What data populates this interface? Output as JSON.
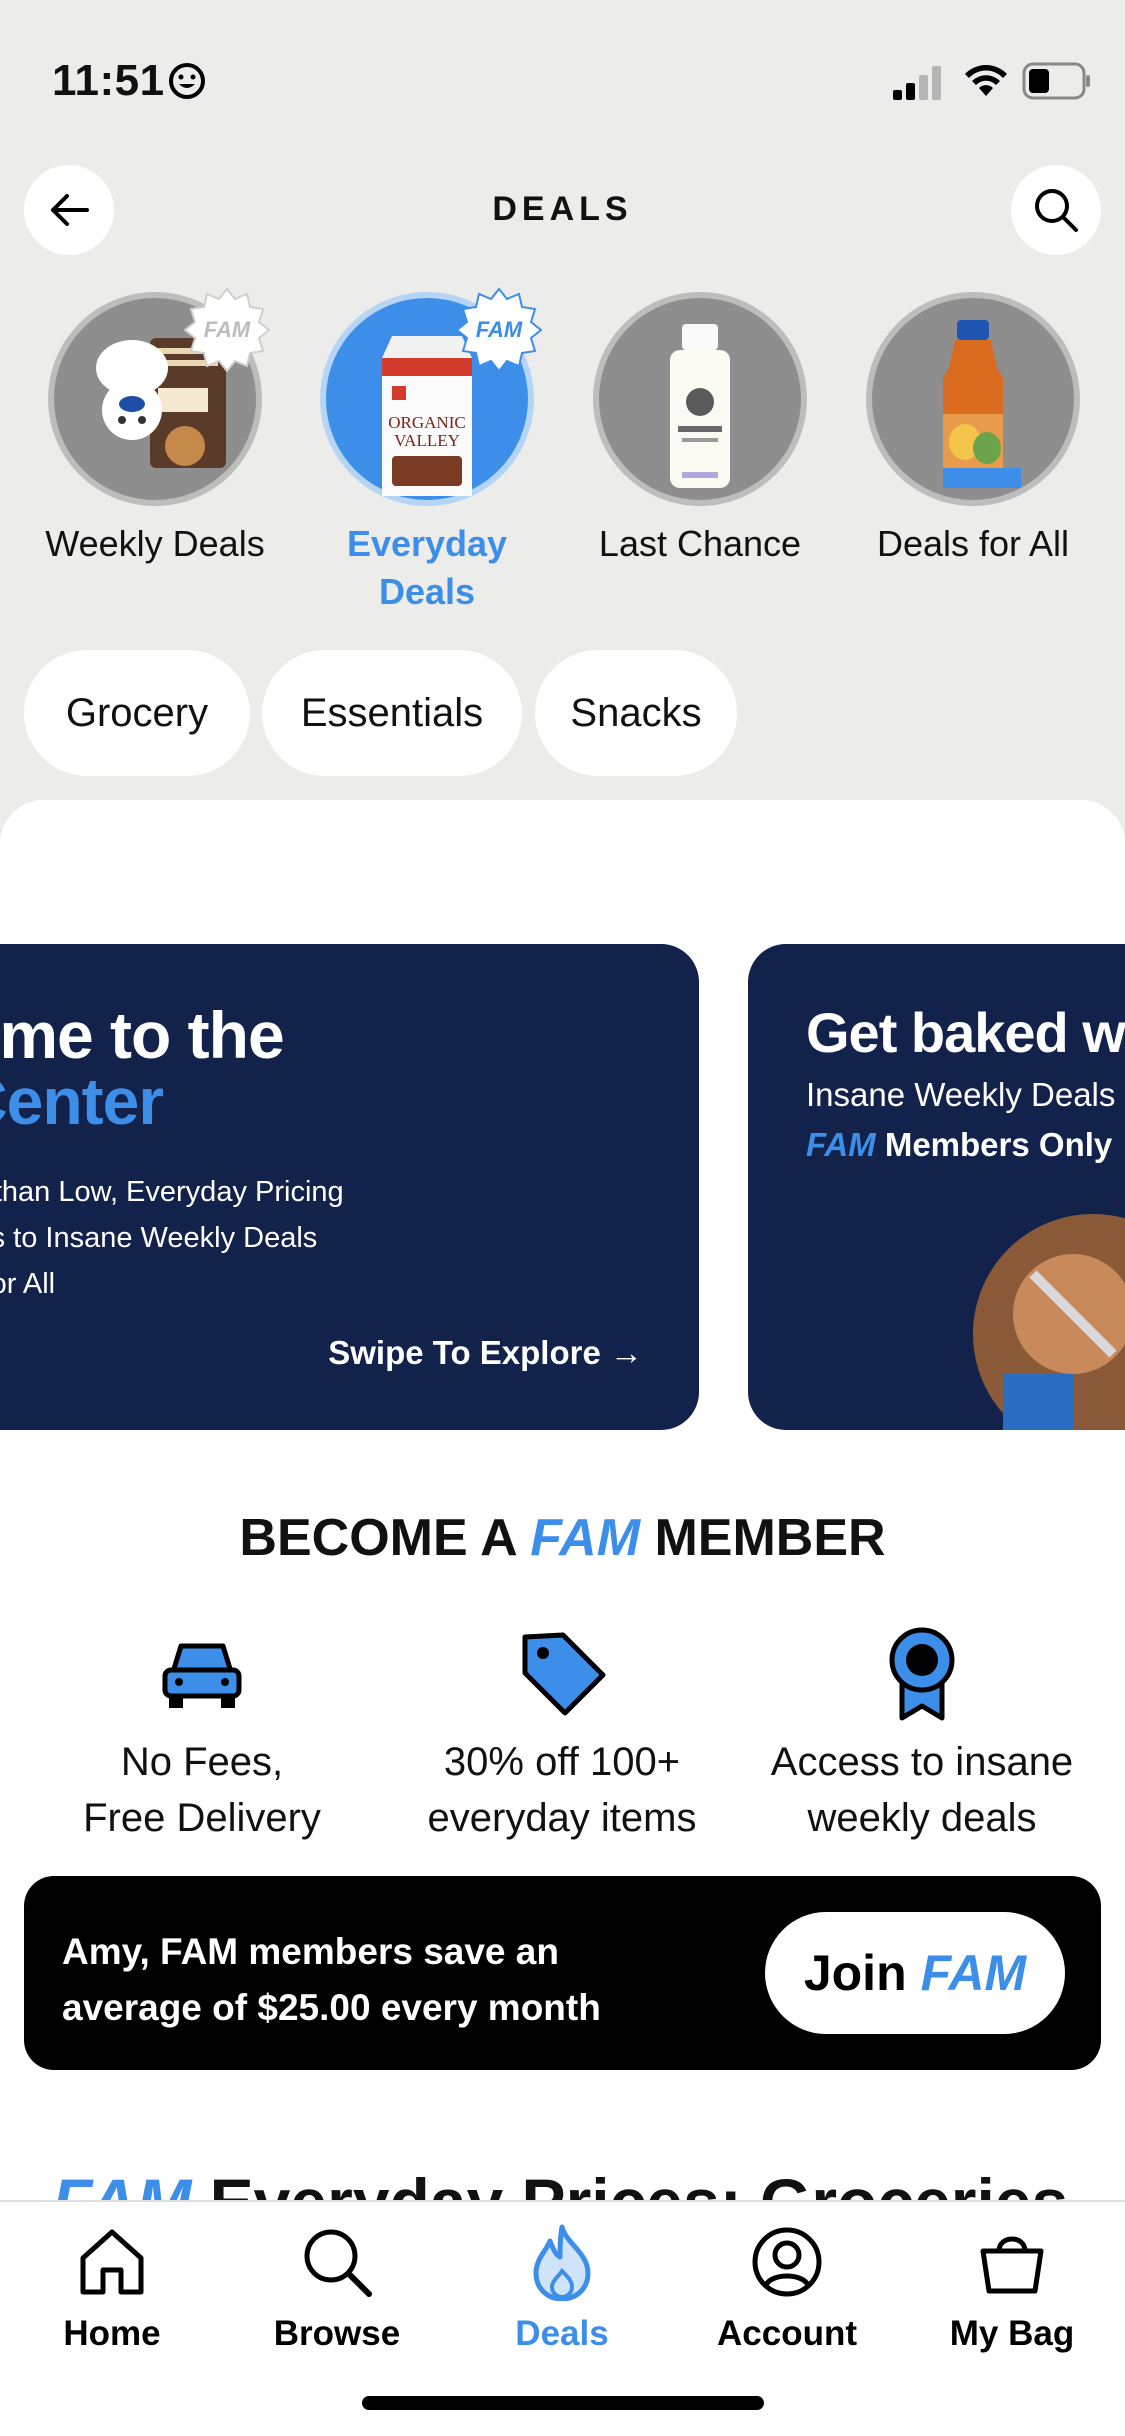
{
  "status": {
    "time": "11:51"
  },
  "header": {
    "title": "DEALS"
  },
  "deal_categories": [
    {
      "label": "Weekly Deals",
      "badge": "FAM",
      "active": false
    },
    {
      "label": "Everyday Deals",
      "badge": "FAM",
      "active": true
    },
    {
      "label": "Last Chance",
      "active": false
    },
    {
      "label": "Deals for All",
      "active": false
    }
  ],
  "chips": [
    "Grocery",
    "Essentials",
    "Snacks"
  ],
  "banners": {
    "welcome": {
      "title_line1": "ome to the",
      "title_line2": "Center",
      "lines": [
        "er than Low, Everyday Pricing",
        "ess to Insane Weekly Deals",
        "s for All"
      ],
      "swipe": "Swipe To Explore →"
    },
    "baked": {
      "title": "Get baked w",
      "subtitle": "Insane Weekly Deals",
      "fam": "FAM",
      "members": "Members Only"
    }
  },
  "membership": {
    "title_pre": "BECOME A ",
    "title_fam": "FAM",
    "title_post": " MEMBER",
    "benefits": [
      {
        "icon": "car-icon",
        "line1": "No Fees,",
        "line2": "Free Delivery"
      },
      {
        "icon": "tag-icon",
        "line1": "30% off 100+",
        "line2": "everyday items"
      },
      {
        "icon": "ribbon-icon",
        "line1": "Access to insane",
        "line2": "weekly deals"
      }
    ],
    "join": {
      "line1": "Amy, FAM members save an",
      "line2": "average of $25.00 every month",
      "button_pre": "Join",
      "button_fam": "FAM"
    }
  },
  "section_peek": {
    "fam": "FAM",
    "title": " Everyday Prices: Groceries"
  },
  "tabs": [
    {
      "label": "Home",
      "icon": "home-icon"
    },
    {
      "label": "Browse",
      "icon": "search-icon"
    },
    {
      "label": "Deals",
      "icon": "flame-icon",
      "active": true
    },
    {
      "label": "Account",
      "icon": "account-icon"
    },
    {
      "label": "My Bag",
      "icon": "bag-icon"
    }
  ],
  "colors": {
    "accent": "#3c8ee8",
    "navy": "#12224a",
    "background": "#ececea"
  }
}
